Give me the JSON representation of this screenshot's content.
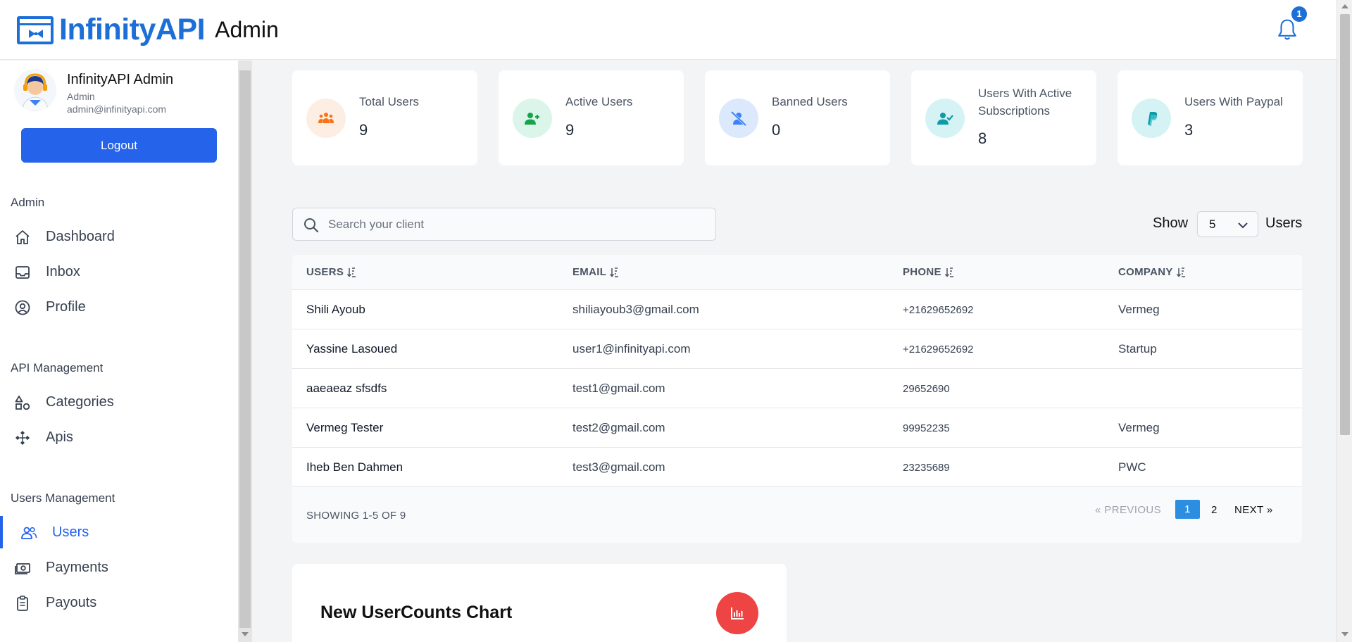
{
  "header": {
    "logo_text": "InfinityAPI",
    "logo_suffix": "Admin",
    "notification_count": "1"
  },
  "sidebar": {
    "profile": {
      "name": "InfinityAPI Admin",
      "role": "Admin",
      "email": "admin@infinityapi.com"
    },
    "logout_label": "Logout",
    "sections": [
      {
        "title": "Admin",
        "items": [
          {
            "label": "Dashboard",
            "icon": "home-icon"
          },
          {
            "label": "Inbox",
            "icon": "inbox-icon"
          },
          {
            "label": "Profile",
            "icon": "user-circle-icon"
          }
        ]
      },
      {
        "title": "API Management",
        "items": [
          {
            "label": "Categories",
            "icon": "shapes-icon"
          },
          {
            "label": "Apis",
            "icon": "nodes-icon"
          }
        ]
      },
      {
        "title": "Users Management",
        "items": [
          {
            "label": "Users",
            "icon": "users-icon",
            "active": true
          },
          {
            "label": "Payments",
            "icon": "money-icon"
          },
          {
            "label": "Payouts",
            "icon": "clipboard-icon"
          }
        ]
      }
    ]
  },
  "stats": [
    {
      "title": "Total Users",
      "value": "9",
      "icon": "users-group-icon",
      "bg": "#fdeee3",
      "fg": "#f97316"
    },
    {
      "title": "Active Users",
      "value": "9",
      "icon": "user-plus-icon",
      "bg": "#dcf5ea",
      "fg": "#16a34a"
    },
    {
      "title": "Banned Users",
      "value": "0",
      "icon": "user-slash-icon",
      "bg": "#dce8fb",
      "fg": "#3b82f6"
    },
    {
      "title": "Users With Active Subscriptions",
      "value": "8",
      "icon": "user-check-icon",
      "bg": "#d5f3f4",
      "fg": "#0e9aa7"
    },
    {
      "title": "Users With Paypal",
      "value": "3",
      "icon": "paypal-icon",
      "bg": "#d5f3f4",
      "fg": "#0e9aa7"
    }
  ],
  "search": {
    "placeholder": "Search your client"
  },
  "show": {
    "prefix": "Show",
    "value": "5",
    "suffix": "Users"
  },
  "table": {
    "columns": [
      "USERS",
      "EMAIL",
      "PHONE",
      "COMPANY"
    ],
    "rows": [
      {
        "user": "Shili Ayoub",
        "email": "shiliayoub3@gmail.com",
        "phone": "+21629652692",
        "company": "Vermeg"
      },
      {
        "user": "Yassine Lasoued",
        "email": "user1@infinityapi.com",
        "phone": "+21629652692",
        "company": "Startup"
      },
      {
        "user": "aaeaeaz sfsdfs",
        "email": "test1@gmail.com",
        "phone": "29652690",
        "company": ""
      },
      {
        "user": "Vermeg Tester",
        "email": "test2@gmail.com",
        "phone": "99952235",
        "company": "Vermeg"
      },
      {
        "user": "Iheb Ben Dahmen",
        "email": "test3@gmail.com",
        "phone": "23235689",
        "company": "PWC"
      }
    ],
    "showing": "SHOWING 1-5 OF 9",
    "pagination": {
      "prev": "«   PREVIOUS",
      "page1": "1",
      "page2": "2",
      "next": "NEXT   »"
    }
  },
  "chart_card": {
    "title": "New UserCounts Chart",
    "icon": "bar-chart-icon"
  }
}
